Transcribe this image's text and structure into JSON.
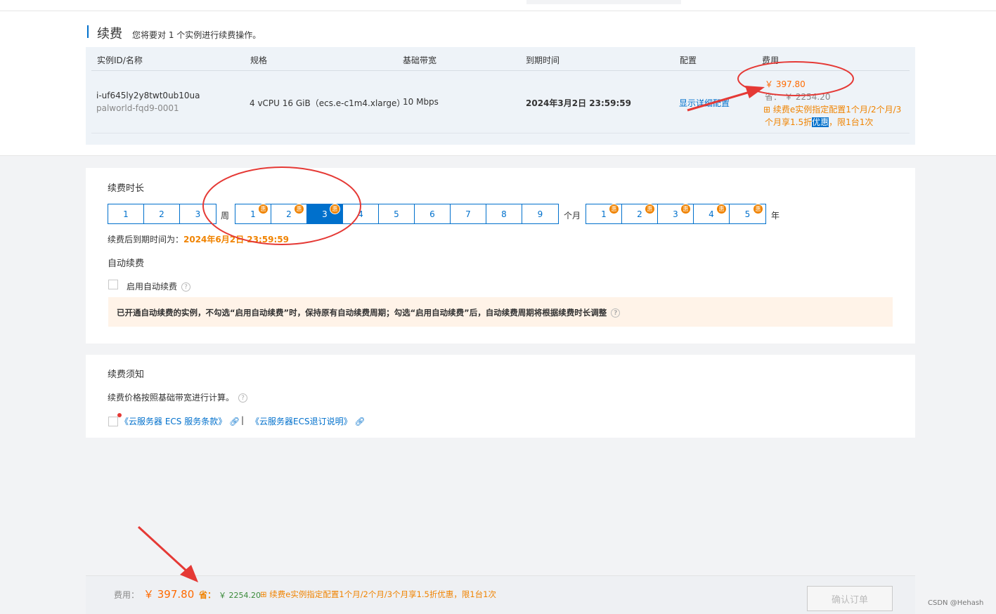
{
  "section": {
    "title": "续费",
    "subtitle": "您将要对 1 个实例进行续费操作。"
  },
  "table": {
    "headers": [
      "实例ID/名称",
      "规格",
      "基础带宽",
      "到期时间",
      "配置",
      "费用"
    ],
    "row": {
      "instance_id": "i-uf645ly2y8twt0ub10ua",
      "instance_name": "palworld-fqd9-0001",
      "spec": "4 vCPU 16 GiB（ecs.e-c1m4.xlarge）",
      "bandwidth": "10 Mbps",
      "expire": "2024年3月2日 23:59:59",
      "config_link": "显示详细配置",
      "price": "￥ 397.80",
      "save_label": "省：",
      "save_value": "￥ 2254.20",
      "promo_line1": "续费e实例指定配置1个月/2个月/3",
      "promo_line2a": "个月享1.5折",
      "promo_line2b": "优惠",
      "promo_line2c": "，限1台1次"
    }
  },
  "duration": {
    "title": "续费时长",
    "weeks": [
      "1",
      "2",
      "3"
    ],
    "week_unit": "周",
    "months": [
      "1",
      "2",
      "3",
      "4",
      "5",
      "6",
      "7",
      "8",
      "9"
    ],
    "month_unit": "个月",
    "years": [
      "1",
      "2",
      "3",
      "4",
      "5"
    ],
    "year_unit": "年",
    "badge_text": "惠",
    "selected_month": "3",
    "after_label": "续费后到期时间为：",
    "after_value": "2024年6月2日 23:59:59"
  },
  "auto_renew": {
    "title": "自动续费",
    "checkbox_label": "启用自动续费",
    "notice": "已开通自动续费的实例，不勾选“启用自动续费”时，保持原有自动续费周期；勾选“启用自动续费”后，自动续费周期将根据续费时长调整"
  },
  "terms": {
    "title": "续费须知",
    "desc": "续费价格按照基础带宽进行计算。",
    "link1": "《云服务器 ECS 服务条款》",
    "separator": "|",
    "link2": "《云服务器ECS退订说明》"
  },
  "footer": {
    "fee_label": "费用：",
    "fee_value": "￥ 397.80",
    "save_label": "省：",
    "save_value": "￥ 2254.20",
    "promo": "续费e实例指定配置1个月/2个月/3个月享1.5折优惠，限1台1次",
    "confirm_button": "确认订单"
  },
  "watermark": "CSDN @Hehash",
  "colors": {
    "primary": "#0070cc",
    "price": "#ff6a00",
    "promo": "#f08300",
    "annotation": "#e53935"
  }
}
